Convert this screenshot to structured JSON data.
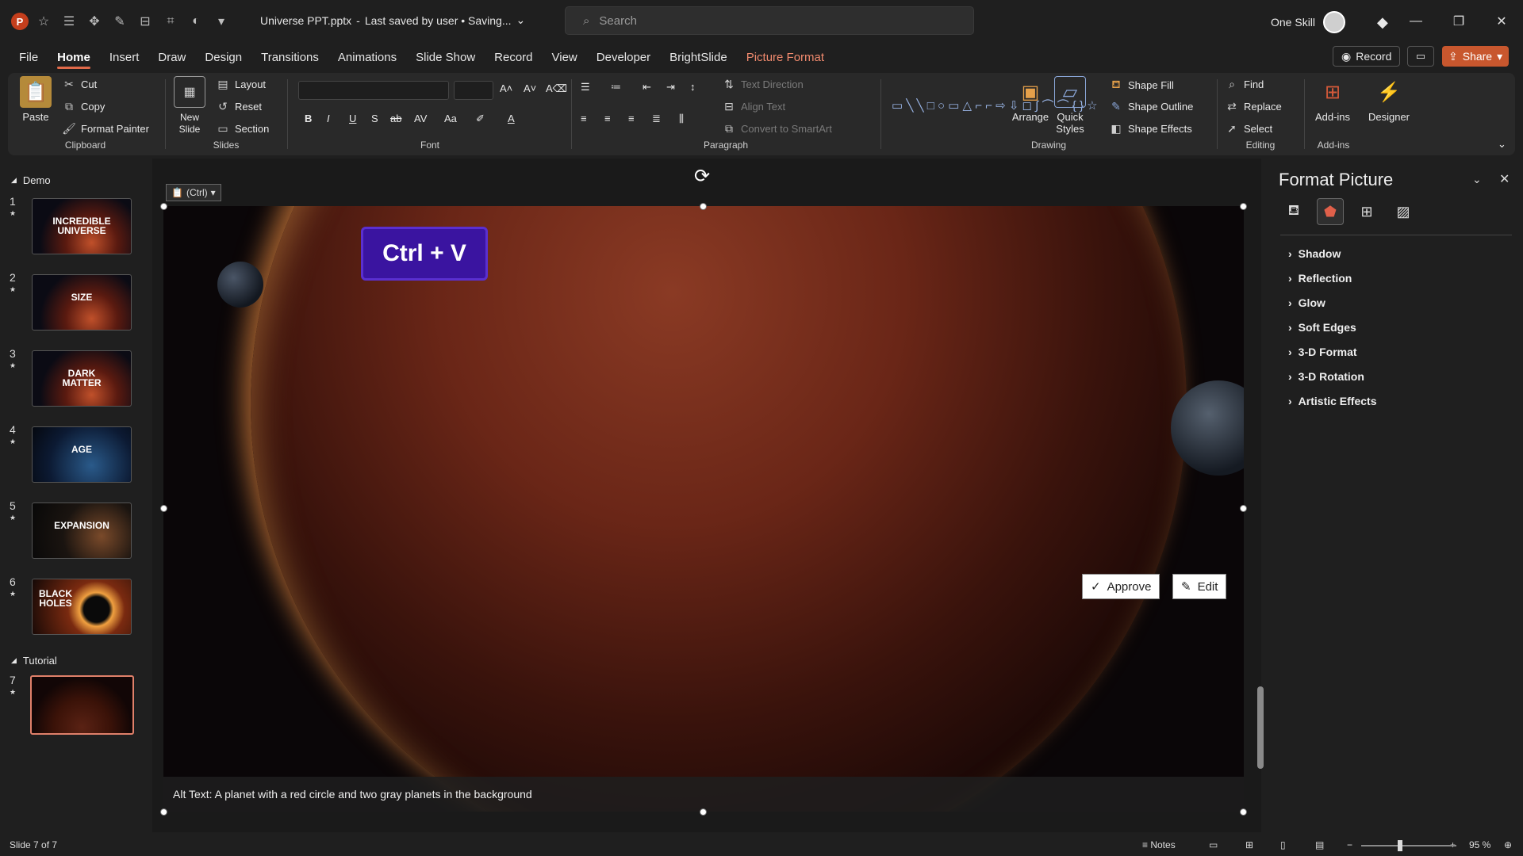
{
  "app": {
    "icon_letter": "P",
    "title": "Universe PPT.pptx",
    "save_status": "Last saved by user • Saving...",
    "search_placeholder": "Search",
    "user_name": "One Skill"
  },
  "tabs": [
    "File",
    "Home",
    "Insert",
    "Draw",
    "Design",
    "Transitions",
    "Animations",
    "Slide Show",
    "Record",
    "View",
    "Developer",
    "BrightSlide",
    "Picture Format"
  ],
  "active_tab": "Home",
  "top_actions": {
    "record": "Record",
    "share": "Share"
  },
  "ribbon": {
    "clipboard": {
      "paste": "Paste",
      "cut": "Cut",
      "copy": "Copy",
      "format_painter": "Format Painter",
      "label": "Clipboard"
    },
    "slides": {
      "new_slide": "New Slide",
      "layout": "Layout",
      "reset": "Reset",
      "section": "Section",
      "label": "Slides"
    },
    "font": {
      "label": "Font",
      "bold": "B",
      "italic": "I",
      "underline": "U",
      "shadow": "S",
      "strike": "ab",
      "case": "Aa"
    },
    "paragraph": {
      "label": "Paragraph",
      "text_direction": "Text Direction",
      "align_text": "Align Text",
      "smartart": "Convert to SmartArt"
    },
    "drawing": {
      "label": "Drawing",
      "arrange": "Arrange",
      "quick_styles": "Quick Styles",
      "shape_fill": "Shape Fill",
      "shape_outline": "Shape Outline",
      "shape_effects": "Shape Effects"
    },
    "editing": {
      "label": "Editing",
      "find": "Find",
      "replace": "Replace",
      "select": "Select"
    },
    "addins": {
      "label": "Add-ins",
      "addins": "Add-ins",
      "designer": "Designer"
    }
  },
  "slides_panel": {
    "sections": [
      {
        "name": "Demo"
      },
      {
        "name": "Tutorial"
      }
    ],
    "thumbs": [
      {
        "num": "1",
        "text": "INCREDIBLE UNIVERSE"
      },
      {
        "num": "2",
        "text": "SIZE"
      },
      {
        "num": "3",
        "text": "DARK MATTER"
      },
      {
        "num": "4",
        "text": "AGE"
      },
      {
        "num": "5",
        "text": "EXPANSION"
      },
      {
        "num": "6",
        "text": "BLACK HOLES"
      },
      {
        "num": "7",
        "text": ""
      }
    ]
  },
  "slide": {
    "paste_options": "(Ctrl)",
    "shortcut_label": "Ctrl + V",
    "alt_text": "Alt Text: A planet with a red circle and two gray planets in the background",
    "approve": "Approve",
    "edit": "Edit"
  },
  "format_pane": {
    "title": "Format Picture",
    "sections": [
      "Shadow",
      "Reflection",
      "Glow",
      "Soft Edges",
      "3-D Format",
      "3-D Rotation",
      "Artistic Effects"
    ]
  },
  "status": {
    "slide_info": "Slide 7 of 7",
    "notes": "Notes",
    "zoom": "95 %"
  },
  "colors": {
    "accent": "#c8572e",
    "picture_format_tab": "#f08a6e",
    "keycap_bg": "#3a14a0"
  }
}
